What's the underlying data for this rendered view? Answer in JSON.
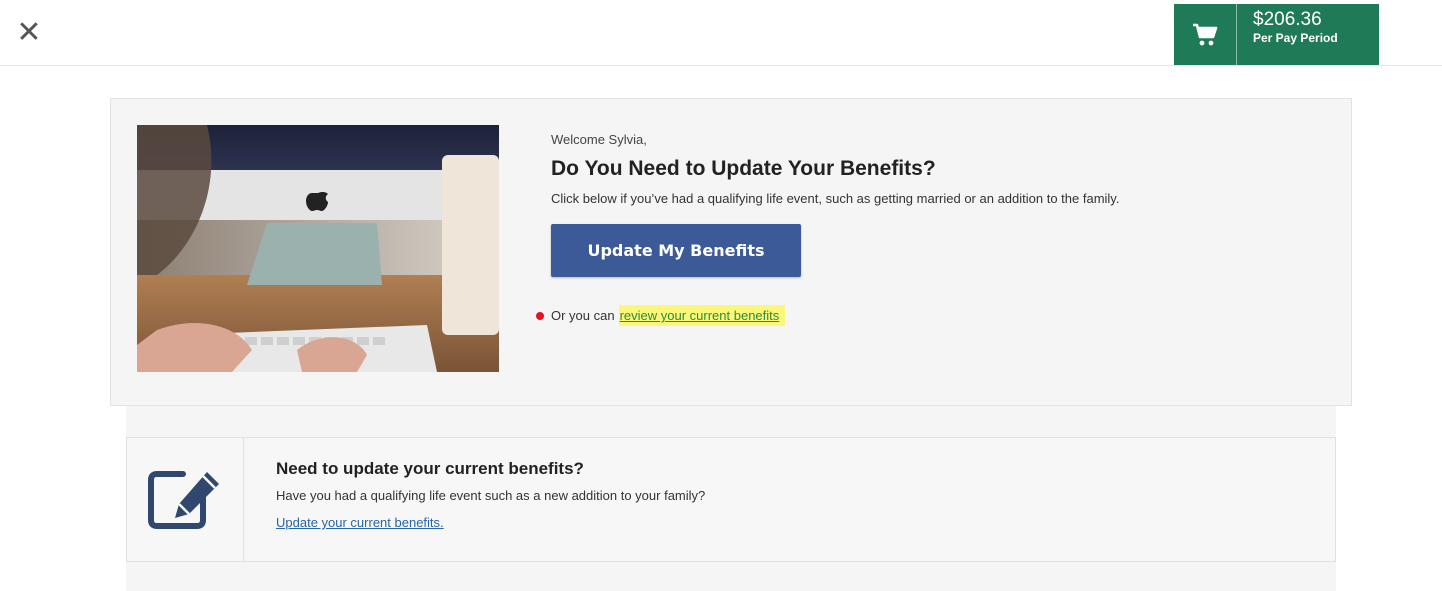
{
  "header": {
    "close_symbol": "✕",
    "cart": {
      "amount": "$206.36",
      "period": "Per Pay Period",
      "icon": "cart-icon",
      "color": "#1f7a57"
    }
  },
  "hero": {
    "welcome": "Welcome Sylvia,",
    "title": "Do You Need to Update Your Benefits?",
    "description": "Click below if you’ve had a qualifying life event, such as getting married or an addition to the family.",
    "button_label": "Update My Benefits",
    "button_color": "#3d5a98",
    "or_text": "Or you can",
    "review_link": "review your current benefits",
    "image_icon": "desk-computer-photo"
  },
  "card": {
    "icon": "edit-icon",
    "title": "Need to update your current benefits?",
    "description": "Have you had a qualifying life event such as a new addition to your family?",
    "link": "Update your current benefits."
  }
}
